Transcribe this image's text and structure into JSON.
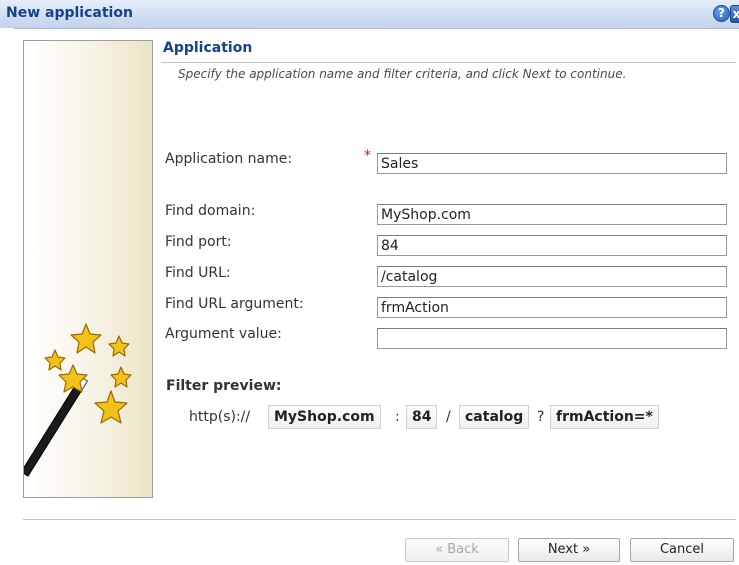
{
  "window": {
    "title": "New application",
    "help_label": "?",
    "close_label": "x"
  },
  "header": {
    "section_title": "Application",
    "description": "Specify the application name and filter criteria, and click Next to continue."
  },
  "form": {
    "required_marker": "*",
    "fields": {
      "app_name": {
        "label": "Application name:",
        "value": "Sales"
      },
      "domain": {
        "label": "Find domain:",
        "value": "MyShop.com"
      },
      "port": {
        "label": "Find port:",
        "value": "84"
      },
      "url": {
        "label": "Find URL:",
        "value": "/catalog"
      },
      "url_argument": {
        "label": "Find URL argument:",
        "value": "frmAction"
      },
      "argument_value": {
        "label": "Argument value:",
        "value": ""
      }
    }
  },
  "preview": {
    "title": "Filter preview:",
    "scheme": "http(s)://",
    "domain": "MyShop.com",
    "sep_port": ":",
    "port": "84",
    "sep_path": "/",
    "path": "catalog",
    "sep_query": "?",
    "query": "frmAction=*"
  },
  "buttons": {
    "back": "« Back",
    "next": "Next »",
    "cancel": "Cancel"
  },
  "colors": {
    "title_text": "#15428b",
    "required": "#d01818",
    "star": "#f2c21b"
  }
}
